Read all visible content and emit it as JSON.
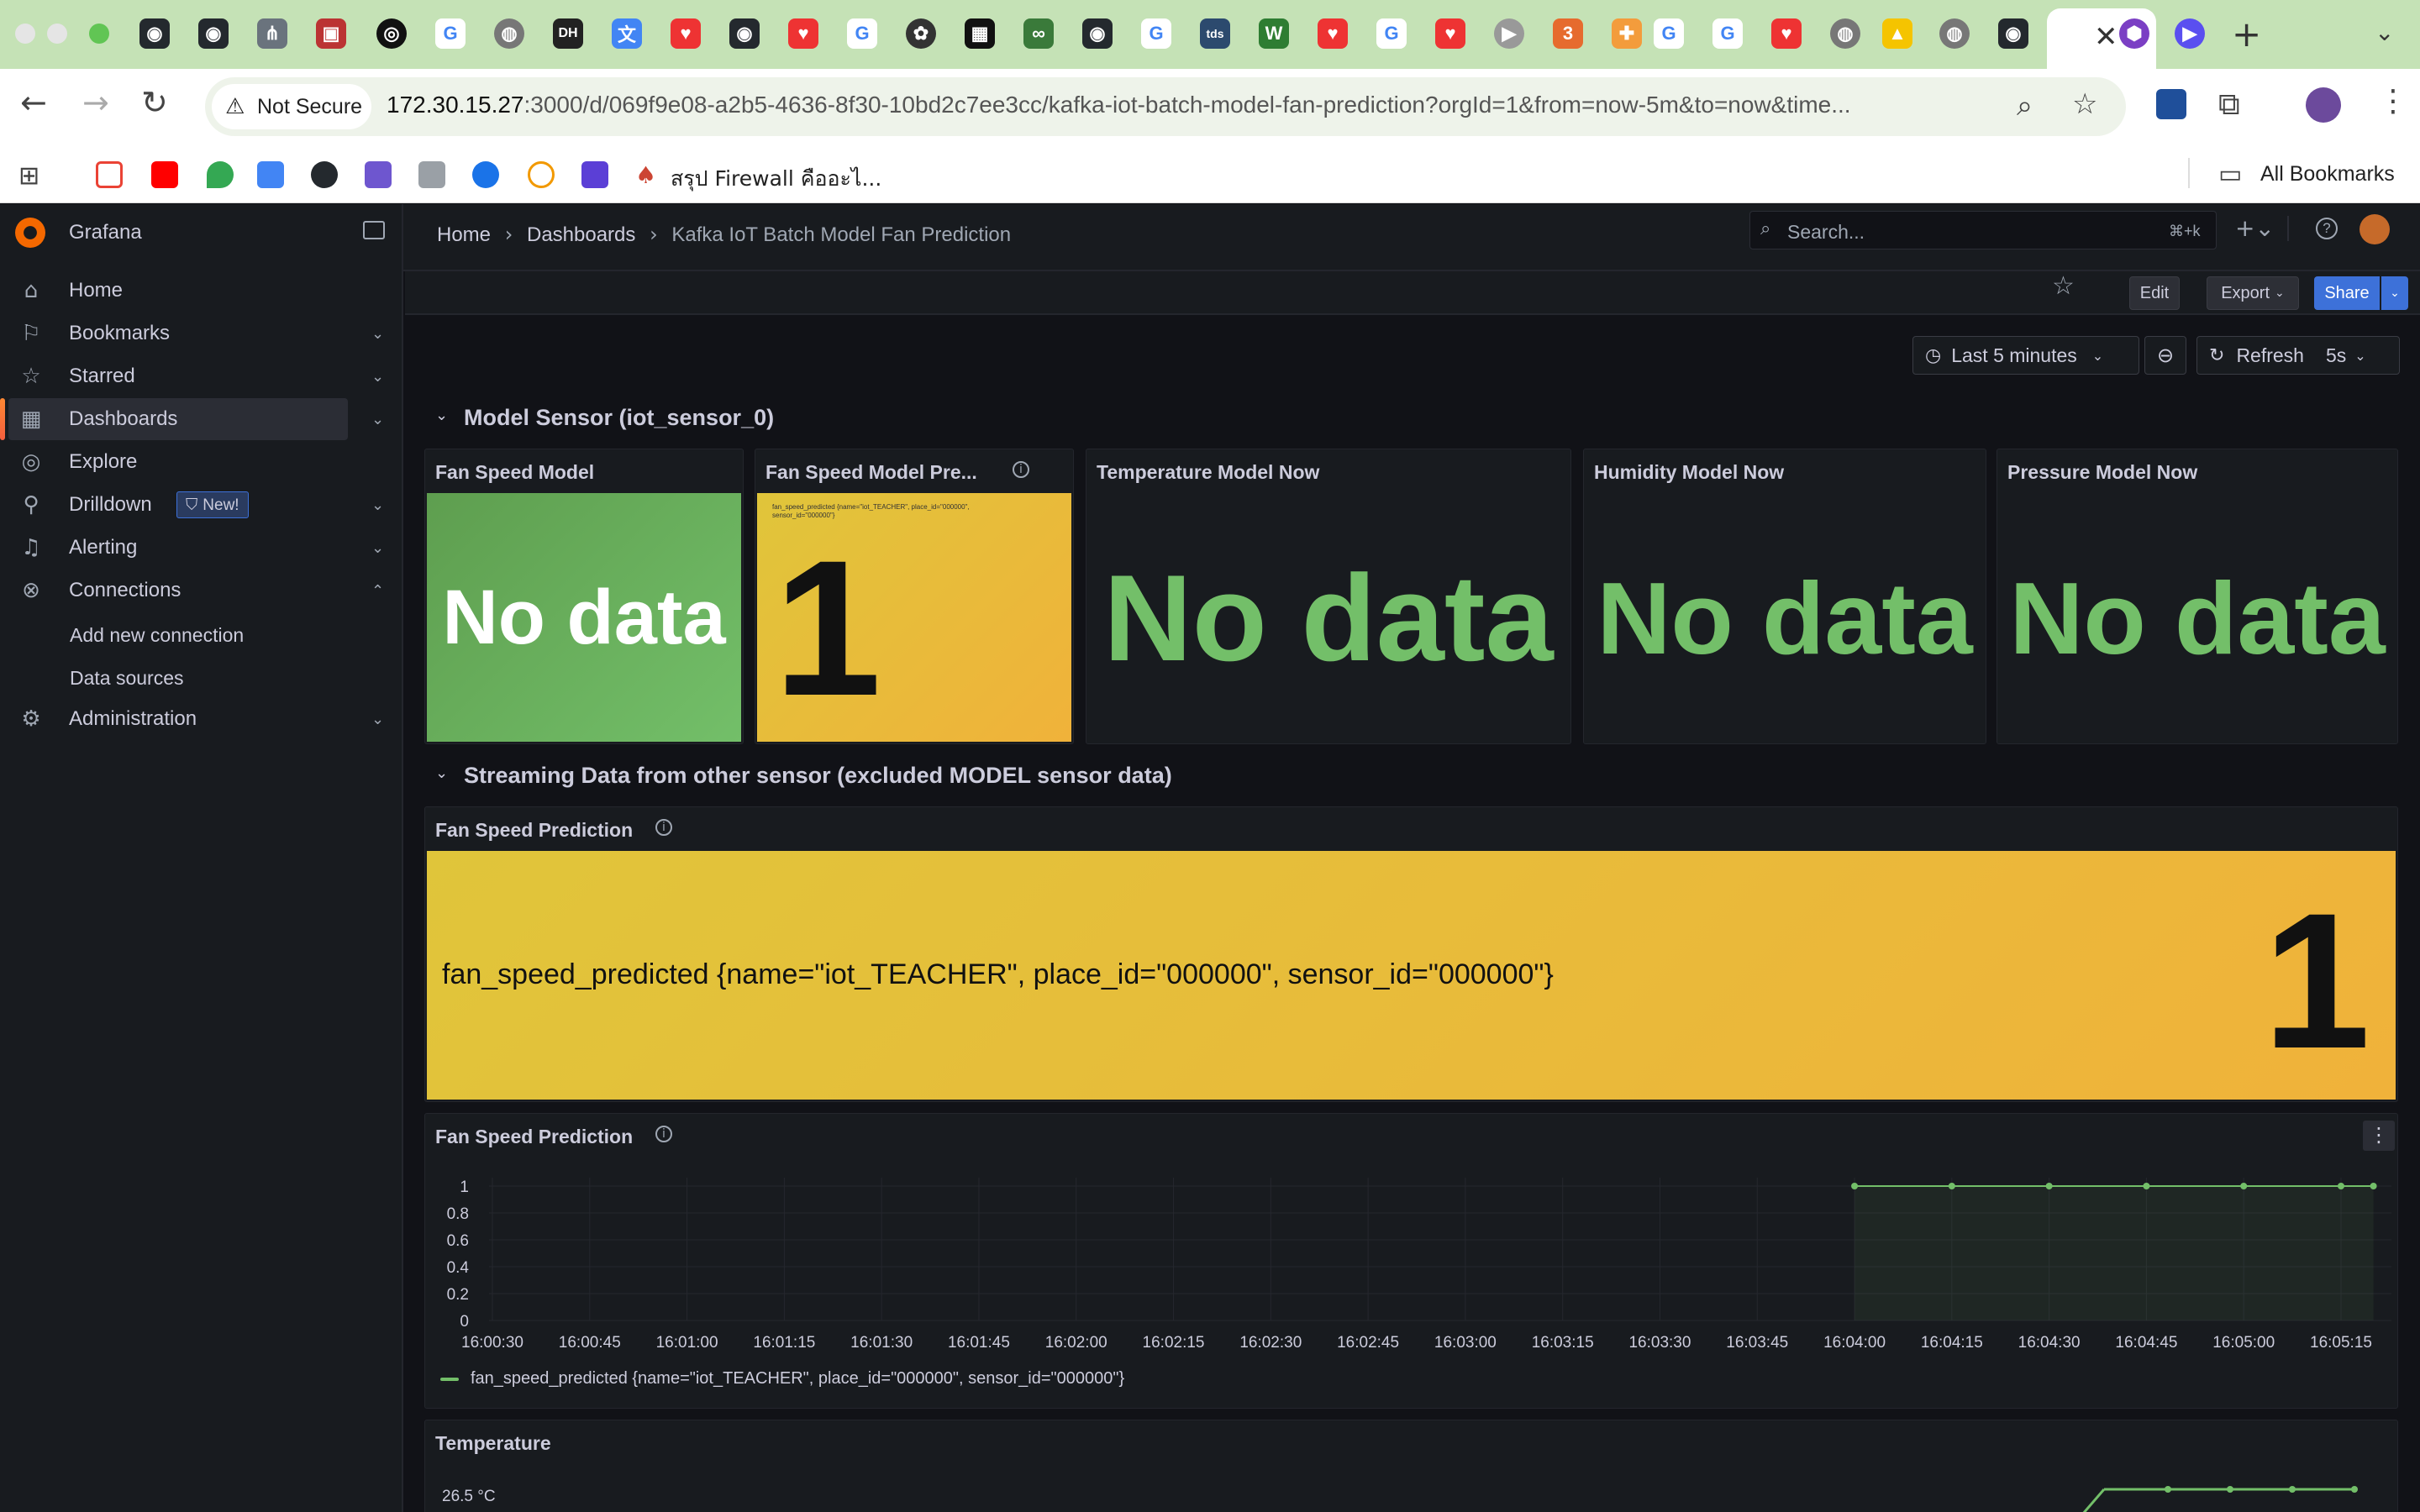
{
  "browser": {
    "address_not_secure": "Not Secure",
    "address_host": "172.30.15.27",
    "address_path": ":3000/d/069f9e08-a2b5-4636-8f30-10bd2c7ee3cc/kafka-iot-batch-model-fan-prediction?orgId=1&from=now-5m&to=now&time...",
    "bookmark_firewall": "สรุป Firewall คืออะไ...",
    "all_bookmarks": "All Bookmarks"
  },
  "grafana": {
    "app_name": "Grafana",
    "breadcrumb": [
      "Home",
      "Dashboards",
      "Kafka IoT Batch Model Fan Prediction"
    ],
    "search_placeholder": "Search...",
    "search_shortcut": "⌘+k",
    "actions": {
      "edit": "Edit",
      "export": "Export",
      "share": "Share"
    },
    "time_range": "Last 5 minutes",
    "refresh_label": "Refresh",
    "refresh_interval": "5s"
  },
  "sidebar": {
    "items": [
      {
        "label": "Home",
        "icon": "home-icon"
      },
      {
        "label": "Bookmarks",
        "icon": "bookmark-icon"
      },
      {
        "label": "Starred",
        "icon": "star-icon"
      },
      {
        "label": "Dashboards",
        "icon": "dashboards-icon"
      },
      {
        "label": "Explore",
        "icon": "compass-icon"
      },
      {
        "label": "Drilldown",
        "icon": "drilldown-icon",
        "badge": "New!"
      },
      {
        "label": "Alerting",
        "icon": "bell-icon"
      },
      {
        "label": "Connections",
        "icon": "connections-icon"
      },
      {
        "label": "Administration",
        "icon": "gear-icon"
      }
    ],
    "connections_sub": [
      "Add new connection",
      "Data sources"
    ]
  },
  "rows": {
    "model_sensor": "Model Sensor (iot_sensor_0)",
    "streaming": "Streaming Data from other sensor (excluded MODEL sensor data)"
  },
  "panels": {
    "fan_speed_model": {
      "title": "Fan Speed Model",
      "value": "No data"
    },
    "fan_speed_model_pred": {
      "title": "Fan Speed Model Pre...",
      "legend": "fan_speed_predicted {name=\"iot_TEACHER\", place_id=\"000000\", sensor_id=\"000000\"}",
      "value": "1"
    },
    "temperature_model": {
      "title": "Temperature Model Now",
      "value": "No data"
    },
    "humidity_model": {
      "title": "Humidity Model Now",
      "value": "No data"
    },
    "pressure_model": {
      "title": "Pressure Model Now",
      "value": "No data"
    },
    "fan_speed_pred_stat": {
      "title": "Fan Speed Prediction",
      "series": "fan_speed_predicted {name=\"iot_TEACHER\", place_id=\"000000\", sensor_id=\"000000\"}",
      "value": "1"
    },
    "fan_speed_pred_ts": {
      "title": "Fan Speed Prediction"
    },
    "temperature_ts": {
      "title": "Temperature",
      "first_tick": "26.5 °C"
    }
  },
  "colors": {
    "green": "#73bf69",
    "stat_green_top": "#5e9e4f",
    "yellow": "#e0c53a",
    "orange": "#f0b23a",
    "primary": "#3d71d9"
  },
  "chart_data": {
    "type": "line",
    "title": "Fan Speed Prediction",
    "x": [
      "16:04:00",
      "16:04:15",
      "16:04:30",
      "16:04:45",
      "16:05:00",
      "16:05:15",
      "16:05:20"
    ],
    "series": [
      {
        "name": "fan_speed_predicted {name=\"iot_TEACHER\", place_id=\"000000\", sensor_id=\"000000\"}",
        "values": [
          1,
          1,
          1,
          1,
          1,
          1,
          1
        ]
      }
    ],
    "x_ticks": [
      "16:00:30",
      "16:00:45",
      "16:01:00",
      "16:01:15",
      "16:01:30",
      "16:01:45",
      "16:02:00",
      "16:02:15",
      "16:02:30",
      "16:02:45",
      "16:03:00",
      "16:03:15",
      "16:03:30",
      "16:03:45",
      "16:04:00",
      "16:04:15",
      "16:04:30",
      "16:04:45",
      "16:05:00",
      "16:05:15"
    ],
    "y_ticks": [
      "0",
      "0.2",
      "0.4",
      "0.6",
      "0.8",
      "1"
    ],
    "ylim": [
      0,
      1
    ],
    "grid": true,
    "legend": "bottom-left"
  }
}
